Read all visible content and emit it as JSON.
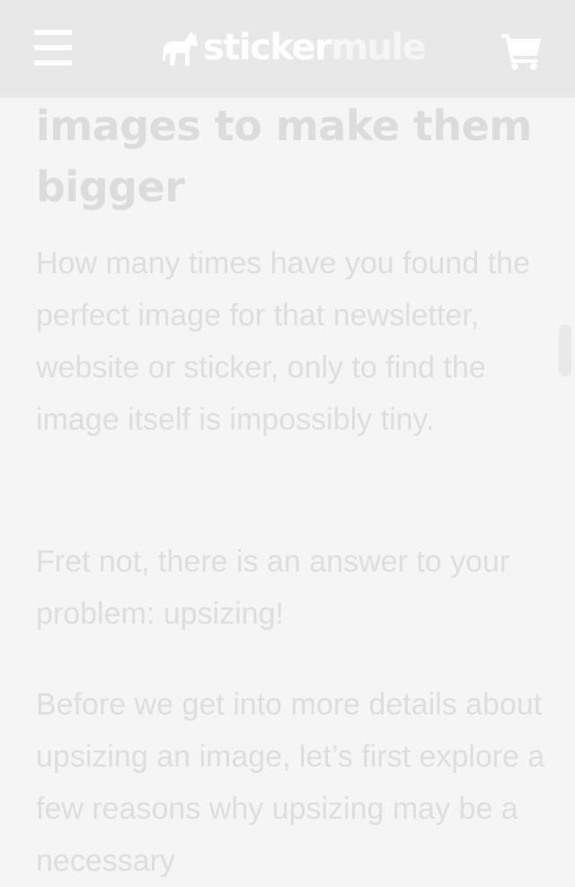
{
  "header": {
    "logo_text_1": "sticker",
    "logo_text_2": "mule",
    "menu_icon": "hamburger-menu-icon",
    "logo_icon": "mule-icon",
    "cart_icon": "shopping-cart-icon"
  },
  "article": {
    "headline": "images to make them bigger",
    "paragraphs": [
      "How many times have you found the perfect image for that newsletter, website or sticker, only to find the image itself is impossibly tiny.",
      "Fret not, there is an answer to your problem: upsizing!",
      "Before we get into more details about upsizing an image, let’s first explore a few reasons why upsizing may be a necessary"
    ]
  },
  "colors": {
    "header_bg": "#e8e8e8",
    "page_bg": "#f5f5f5",
    "text": "#dedede"
  }
}
